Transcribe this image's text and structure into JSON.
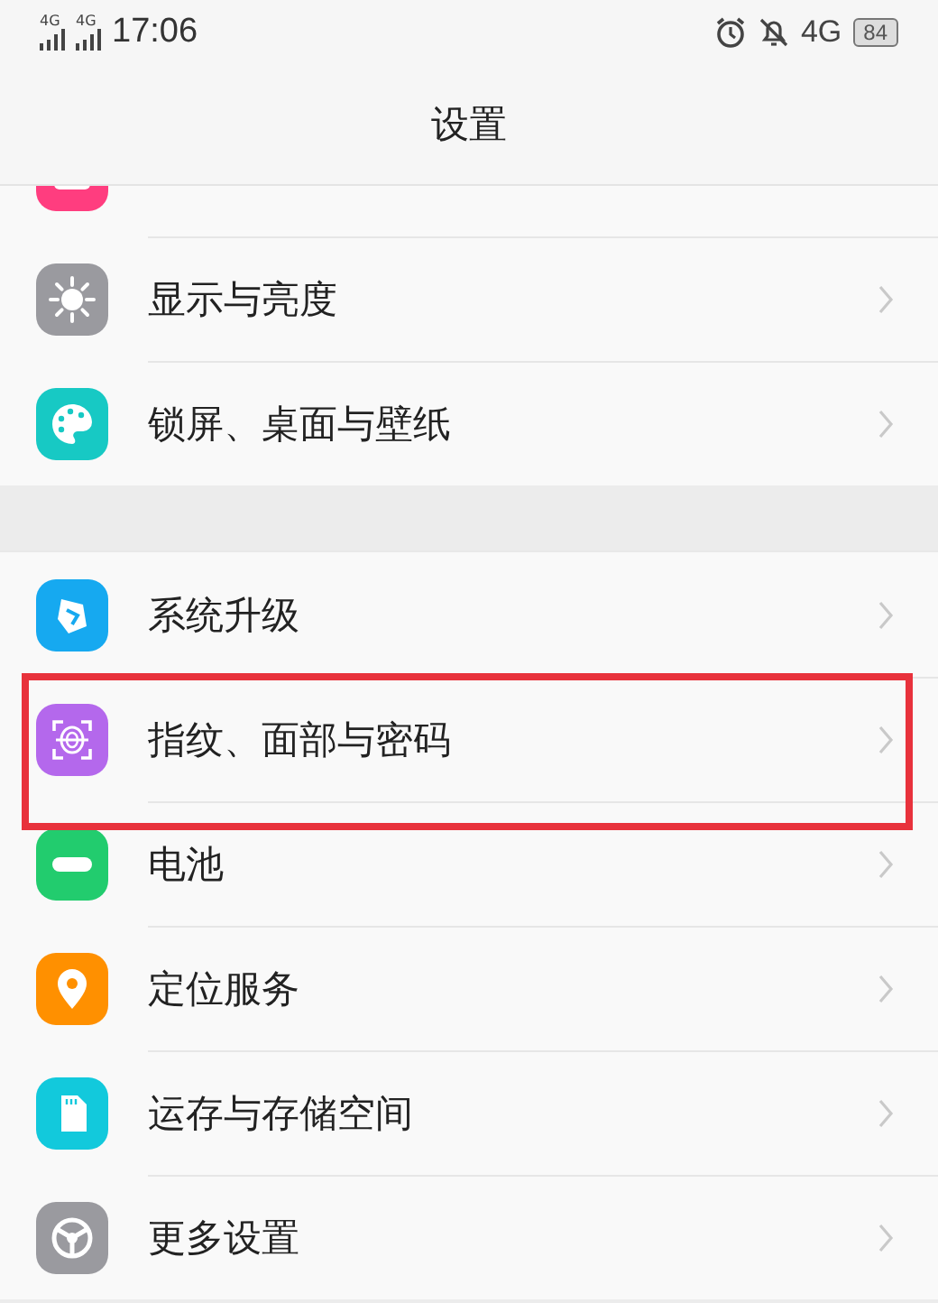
{
  "status_bar": {
    "signals": [
      {
        "label": "4G"
      },
      {
        "label": "4G"
      }
    ],
    "time": "17:06",
    "network": "4G",
    "battery": "84"
  },
  "title": "设置",
  "groups": [
    {
      "items": [
        {
          "kind": "partial"
        },
        {
          "kind": "item",
          "label": "显示与亮度",
          "highlighted": false
        },
        {
          "kind": "item",
          "label": "锁屏、桌面与壁纸",
          "highlighted": false
        }
      ]
    },
    {
      "items": [
        {
          "kind": "item",
          "label": "系统升级",
          "highlighted": false
        },
        {
          "kind": "item",
          "label": "指纹、面部与密码",
          "highlighted": true
        },
        {
          "kind": "item",
          "label": "电池",
          "highlighted": false
        },
        {
          "kind": "item",
          "label": "定位服务",
          "highlighted": false
        },
        {
          "kind": "item",
          "label": "运存与存储空间",
          "highlighted": false
        },
        {
          "kind": "item",
          "label": "更多设置",
          "highlighted": false
        }
      ]
    }
  ]
}
